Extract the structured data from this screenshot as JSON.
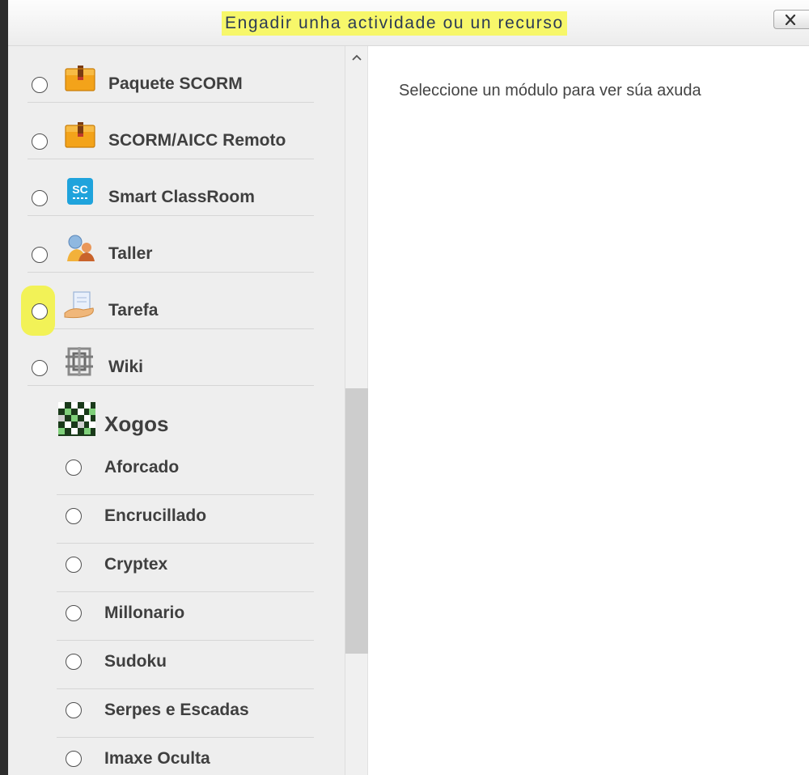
{
  "dialog": {
    "title": "Engadir unha actividade ou un recurso",
    "close_icon": "close-x-icon"
  },
  "activities": [
    {
      "label": "Paquete SCORM",
      "icon": "package-icon"
    },
    {
      "label": "SCORM/AICC Remoto",
      "icon": "package-icon"
    },
    {
      "label": "Smart ClassRoom",
      "icon": "smart-classroom-icon",
      "icon_text": "SC"
    },
    {
      "label": "Taller",
      "icon": "workshop-icon"
    },
    {
      "label": "Tarefa",
      "icon": "assignment-icon"
    },
    {
      "label": "Wiki",
      "icon": "wiki-icon"
    }
  ],
  "games_group": {
    "label": "Xogos",
    "icon": "games-icon",
    "items": [
      {
        "label": "Aforcado"
      },
      {
        "label": "Encrucillado"
      },
      {
        "label": "Cryptex"
      },
      {
        "label": "Millonario"
      },
      {
        "label": "Sudoku"
      },
      {
        "label": "Serpes e Escadas"
      },
      {
        "label": "Imaxe Oculta"
      }
    ]
  },
  "help_panel": {
    "text": "Seleccione un módulo para ver súa axuda"
  },
  "colors": {
    "highlight": "#f2f257",
    "accent_blue": "#1fa3dc",
    "package_orange": "#f3a31a"
  }
}
